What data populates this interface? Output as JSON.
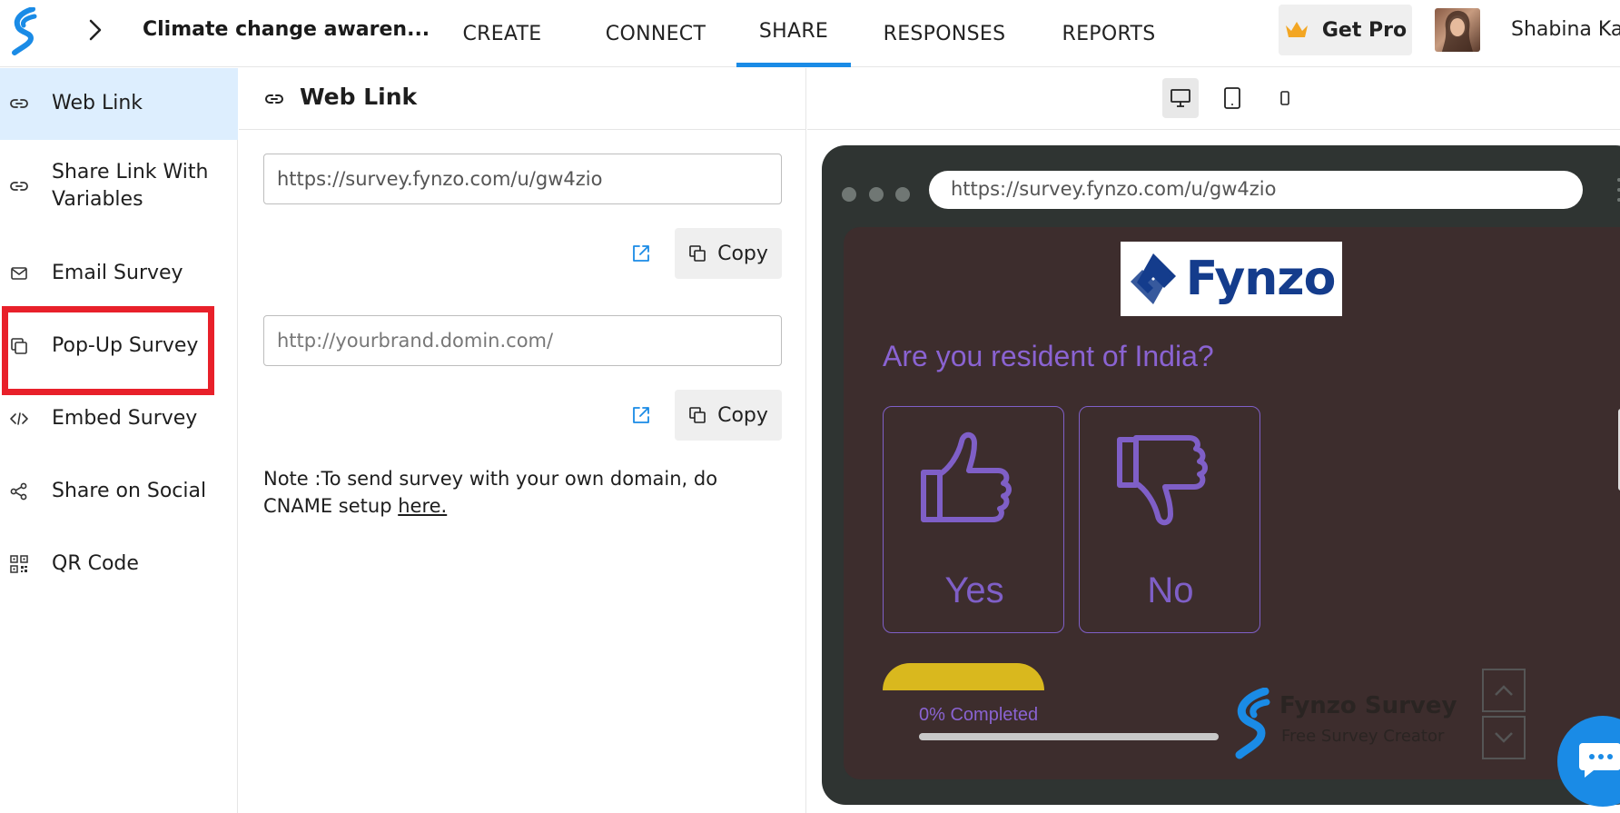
{
  "header": {
    "survey_title": "Climate change awaren...",
    "nav": [
      {
        "label": "CREATE"
      },
      {
        "label": "CONNECT"
      },
      {
        "label": "SHARE"
      },
      {
        "label": "RESPONSES"
      },
      {
        "label": "REPORTS"
      }
    ],
    "active_tab": "SHARE",
    "get_pro_label": "Get Pro",
    "user_name": "Shabina Kau"
  },
  "sidebar": {
    "items": [
      {
        "label": "Web Link",
        "icon": "link-icon"
      },
      {
        "label": "Share Link With Variables",
        "icon": "link-icon"
      },
      {
        "label": "Email Survey",
        "icon": "envelope-icon"
      },
      {
        "label": "Pop-Up Survey",
        "icon": "popup-icon"
      },
      {
        "label": "Embed Survey",
        "icon": "code-icon"
      },
      {
        "label": "Share on Social",
        "icon": "share-icon"
      },
      {
        "label": "QR Code",
        "icon": "qr-code-icon"
      }
    ],
    "active_item": "Web Link",
    "highlighted_item": "Pop-Up Survey"
  },
  "panel": {
    "title": "Web Link",
    "survey_url": "https://survey.fynzo.com/u/gw4zio",
    "custom_domain_placeholder": "http://yourbrand.domin.com/",
    "copy_label": "Copy",
    "note_text": "Note :To send survey with your own domain, do CNAME setup ",
    "note_link": "here."
  },
  "preview": {
    "address_bar": "https://survey.fynzo.com/u/gw4zio",
    "brand_name": "Fynzo",
    "question": "Are you resident of India?",
    "choices": [
      {
        "label": "Yes",
        "icon": "thumbs-up-icon"
      },
      {
        "label": "No",
        "icon": "thumbs-down-icon"
      }
    ],
    "progress_text": "0% Completed",
    "progress_value": 0,
    "footer_brand": "Fynzo Survey",
    "footer_tagline": "Free Survey Creator"
  },
  "colors": {
    "accent": "#1a8be6",
    "highlight": "#e8202a",
    "preview_bg": "#3d2d2d",
    "question_purple": "#8a63d2",
    "progress_yellow": "#d9b81e"
  }
}
